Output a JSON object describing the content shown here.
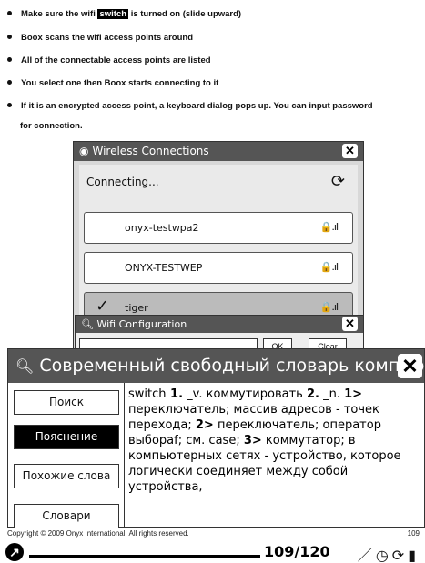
{
  "manual": {
    "bullet1_pre": "Make sure the wifi",
    "bullet1_hl": "switch",
    "bullet1_post": "is turned on (slide upward)",
    "bullet2": "Boox scans the wifi access points around",
    "bullet3": "All of the connectable access points are listed",
    "bullet4": "You select one then Boox starts connecting to it",
    "bullet5": "If it is an encrypted access point, a keyboard dialog pops up. You can input password",
    "bullet5_cont": "for connection."
  },
  "wireless": {
    "title": "Wireless Connections",
    "status": "Connecting...",
    "access_points": [
      {
        "name": "onyx-testwpa2",
        "selected": false
      },
      {
        "name": "ONYX-TESTWEP",
        "selected": false
      },
      {
        "name": "tiger",
        "selected": true
      }
    ]
  },
  "wifi_config": {
    "title": "Wifi Configuration",
    "ok_label": "OK",
    "clear_label": "Clear"
  },
  "dictionary": {
    "title": "Современный свободный словарь компьютерной лексики",
    "buttons": {
      "search": "Поиск",
      "explain": "Пояснение",
      "similar": "Похожие слова",
      "dicts": "Словари"
    },
    "headword": "switch",
    "definition_parts": [
      {
        "b": "1.",
        "t": " _v. коммутировать "
      },
      {
        "b": "2.",
        "t": " _n. "
      },
      {
        "b": "1>",
        "t": " переключатель; массив адресов - точек перехода; "
      },
      {
        "b": "2>",
        "t": " переключатель; оператор выбора"
      },
      {
        "b": "",
        "t": "f; см. case; "
      },
      {
        "b": "3>",
        "t": " коммутатор; в компьютерных сетях - устройство, которое логически соединяет между собой устройства,"
      }
    ]
  },
  "footer": {
    "copyright": "Copyright © 2009 Onyx International. All rights reserved.",
    "page_number": "109"
  },
  "status_bar": {
    "page_indicator": "109/120",
    "progress": 0.908
  }
}
